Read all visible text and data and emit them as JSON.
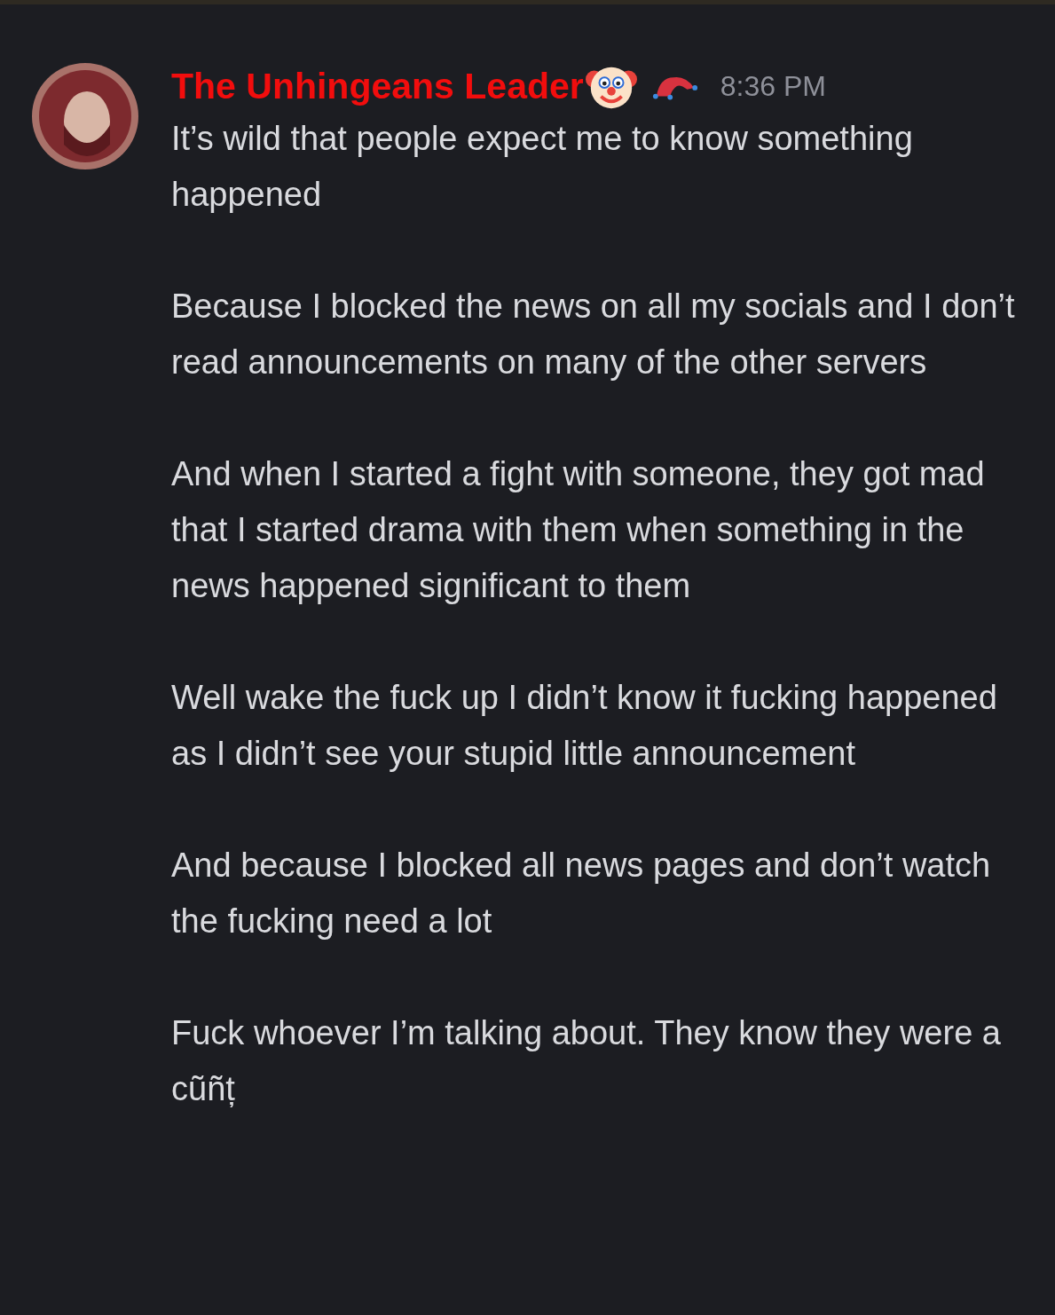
{
  "message": {
    "author": "The Unhingeans Leader",
    "timestamp": "8:36 PM",
    "paragraphs": [
      "It’s wild that people expect me to know something happened",
      "Because I blocked the news on all my socials and I don’t read announcements on many of the other servers",
      "And when I started a fight with someone, they got mad that I started drama with them when something in the news happened significant to them",
      "Well wake the fuck up I didn’t know it fucking happened as I didn’t see your stupid little announcement",
      "And because I blocked all news pages and don’t watch the fucking need a lot",
      "Fuck whoever I’m talking about. They know they were a cũñț"
    ]
  }
}
